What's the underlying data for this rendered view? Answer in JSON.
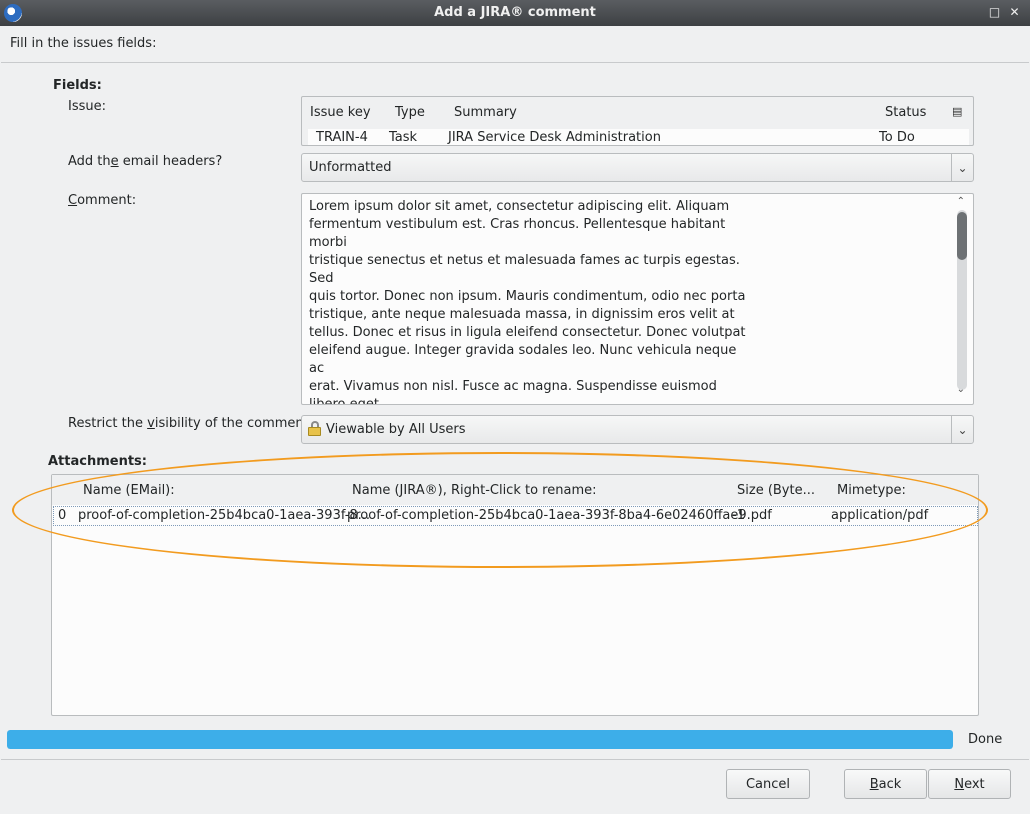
{
  "window": {
    "title": "Add a JIRA® comment",
    "header_text": "Fill in the issues fields:"
  },
  "fields": {
    "section_label": "Fields:",
    "issue_label": "Issue:",
    "issue_table": {
      "columns": [
        "Issue key",
        "Type",
        "Summary",
        "Status"
      ],
      "rows": [
        {
          "key": "TRAIN-4",
          "type": "Task",
          "summary": "JIRA Service Desk Administration",
          "status": "To Do"
        }
      ]
    },
    "email_headers_label_pre": "Add th",
    "email_headers_label_mn": "e",
    "email_headers_label_post": " email headers?",
    "email_headers_value": "Unformatted",
    "comment_label_mn": "C",
    "comment_label_post": "omment:",
    "comment_text": "Lorem ipsum dolor sit amet, consectetur adipiscing elit. Aliquam\nfermentum vestibulum est. Cras rhoncus. Pellentesque habitant morbi\ntristique senectus et netus et malesuada fames ac turpis egestas. Sed\nquis tortor. Donec non ipsum. Mauris condimentum, odio nec porta\ntristique, ante neque malesuada massa, in dignissim eros velit at\ntellus. Donec et risus in ligula eleifend consectetur. Donec volutpat\neleifend augue. Integer gravida sodales leo. Nunc vehicula neque ac\nerat. Vivamus non nisl. Fusce ac magna. Suspendisse euismod libero eget\nmauris.\n\nUt ligula. Maecenas consequat. Aliquam placerat. Cum sociis natoque",
    "visibility_label_pre": "Restrict the ",
    "visibility_label_mn": "v",
    "visibility_label_post": "isibility of the comment?",
    "visibility_value": "Viewable by All Users"
  },
  "attachments": {
    "section_label": "Attachments:",
    "columns": [
      "Name (EMail):",
      "Name (JIRA®), Right-Click to rename:",
      "Size (Byte...",
      "Mimetype:"
    ],
    "rows": [
      {
        "index": "0",
        "email_name": "proof-of-completion-25b4bca0-1aea-393f-8...",
        "jira_name": "proof-of-completion-25b4bca0-1aea-393f-8ba4-6e02460ffae9.pdf",
        "size": "-1",
        "mimetype": "application/pdf"
      }
    ]
  },
  "progress": {
    "value_percent": 100,
    "status_text": "Done",
    "color": "#3daee9"
  },
  "buttons": {
    "cancel": "Cancel",
    "back_mn": "B",
    "back_post": "ack",
    "next_mn": "N",
    "next_post": "ext"
  },
  "icons": {
    "app": "thunderbird-icon",
    "visibility": "lock-icon",
    "column_chooser": "column-picker-icon"
  },
  "colors": {
    "highlight_ellipse": "#f29b1f",
    "accent": "#3daee9"
  }
}
